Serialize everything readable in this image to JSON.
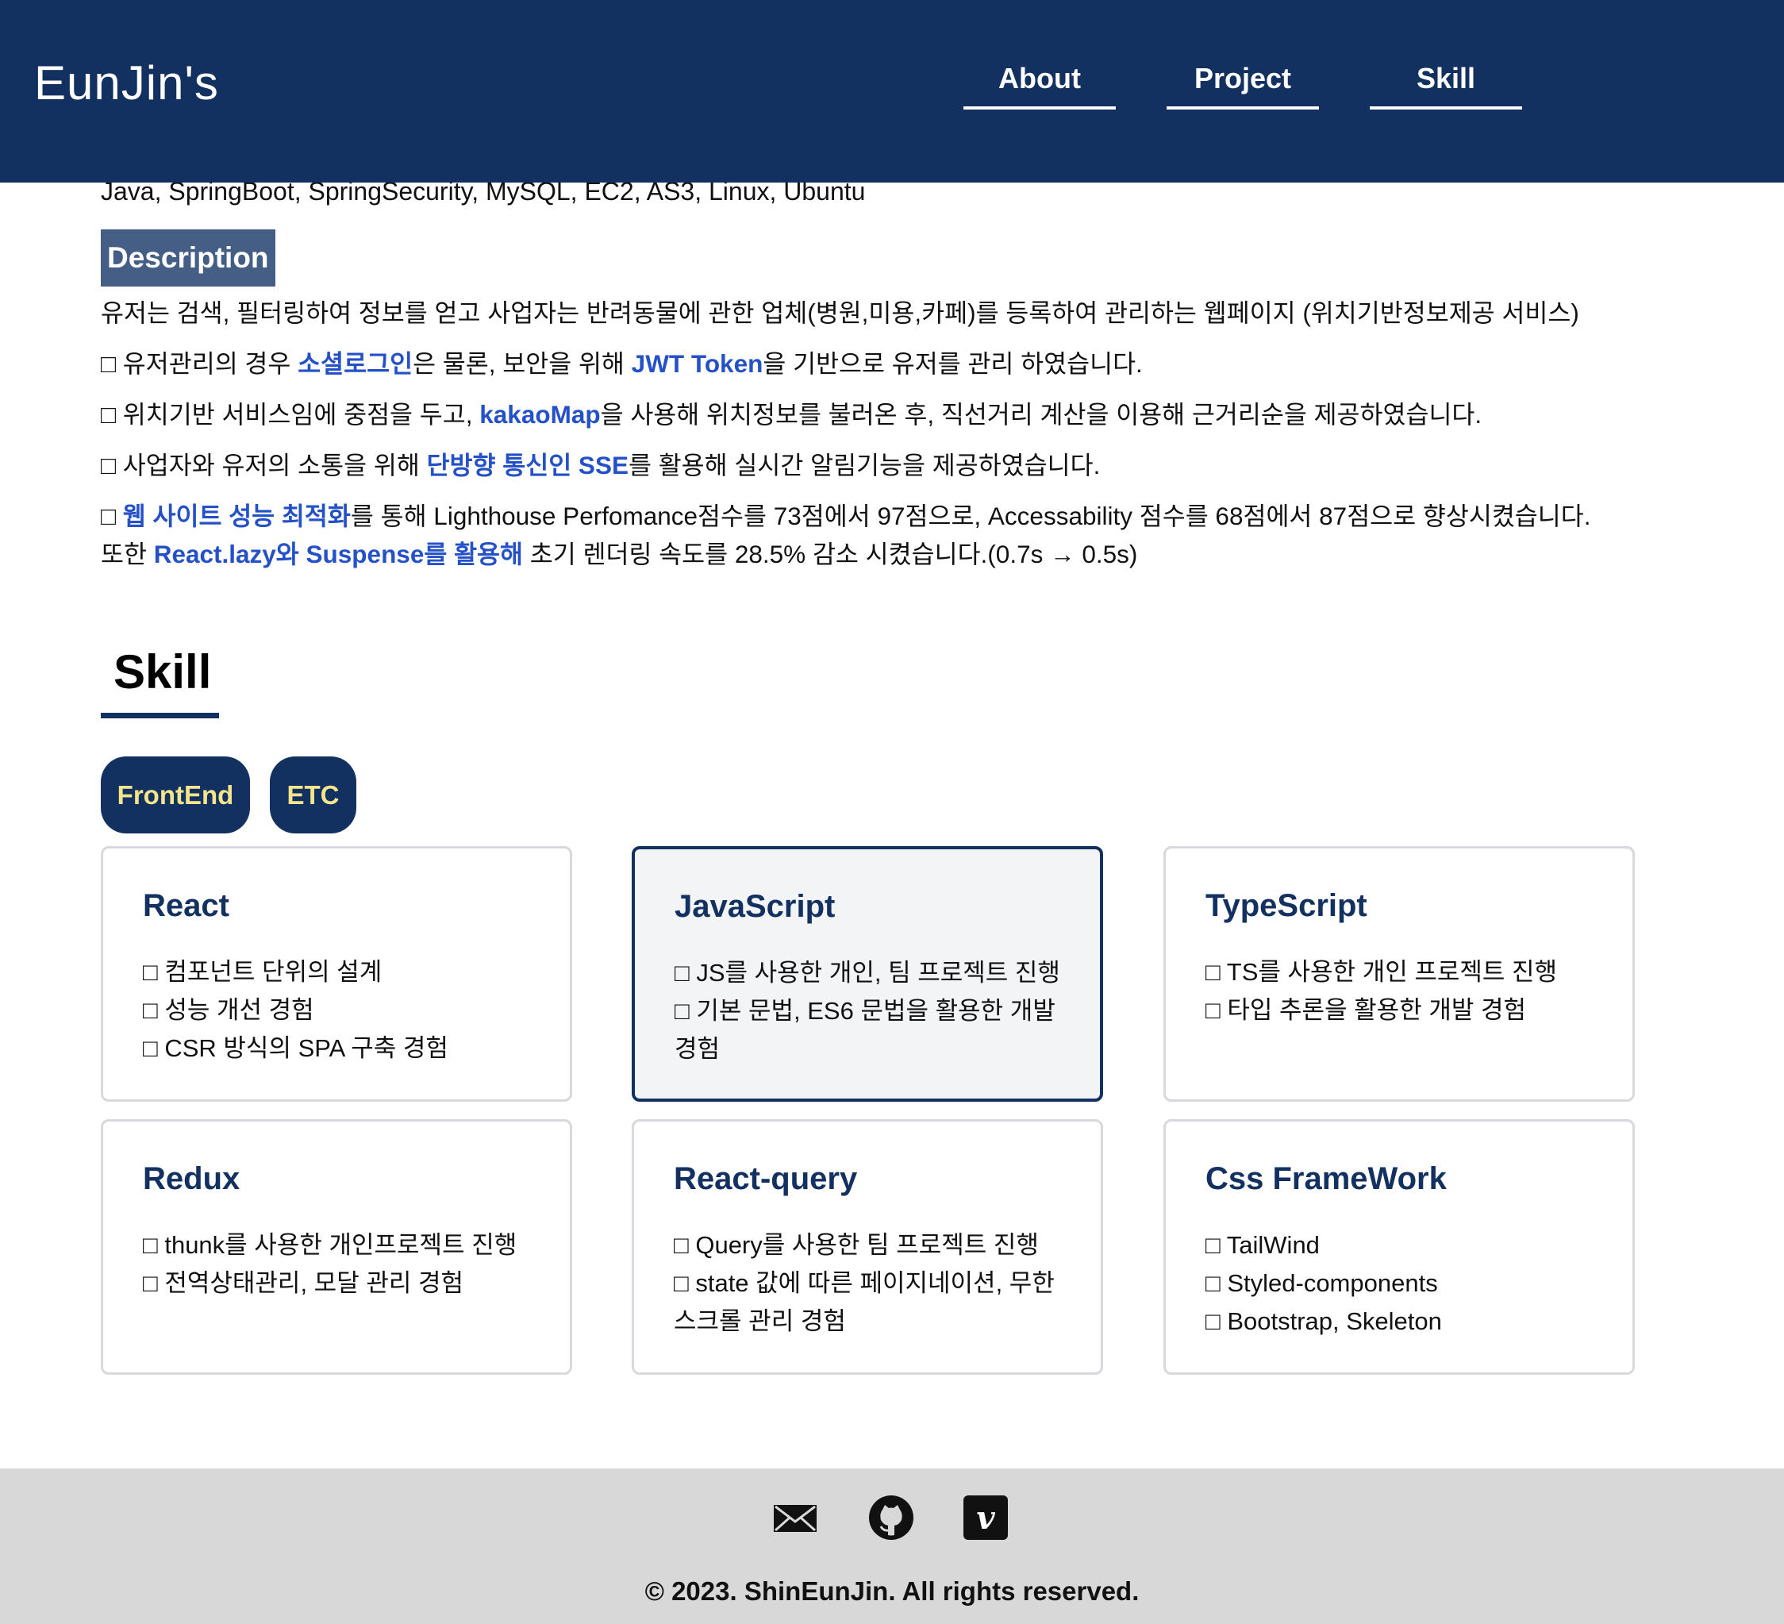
{
  "header": {
    "logo": "EunJin's",
    "nav": [
      "About",
      "Project",
      "Skill"
    ]
  },
  "project": {
    "tech_stack": "Java, SpringBoot, SpringSecurity, MySQL, EC2, AS3, Linux, Ubuntu",
    "description_label": "Description",
    "summary": "유저는 검색, 필터링하여 정보를 얻고 사업자는 반려동물에 관한 업체(병원,미용,카페)를 등록하여 관리하는 웹페이지 (위치기반정보제공 서비스)",
    "bullets": [
      {
        "pre": "□ 유저관리의 경우 ",
        "h1": "소셜로그인",
        "mid": "은 물론, 보안을 위해 ",
        "h2": "JWT Token",
        "post": "을 기반으로 유저를 관리 하였습니다."
      },
      {
        "pre": "□ 위치기반 서비스임에 중점을 두고, ",
        "h1": "kakaoMap",
        "mid": "을 사용해 위치정보를 불러온 후, 직선거리 계산을 이용해 근거리순을 제공하였습니다.",
        "h2": "",
        "post": ""
      },
      {
        "pre": "□ 사업자와 유저의 소통을 위해 ",
        "h1": "단방향 통신인 SSE",
        "mid": "를 활용해 실시간 알림기능을 제공하였습니다.",
        "h2": "",
        "post": ""
      },
      {
        "pre": "□ ",
        "h1": "웹 사이트 성능 최적화",
        "mid": "를 통해 Lighthouse Perfomance점수를 73점에서 97점으로, Accessability 점수를 68점에서 87점으로 향상시켰습니다.",
        "h2": "",
        "post": ""
      }
    ],
    "last_line": {
      "pre": "또한 ",
      "h1": "React.lazy와 Suspense를 활용해",
      "post": " 초기 렌더링 속도를 28.5% 감소 시켰습니다.(0.7s → 0.5s)"
    }
  },
  "skill": {
    "title": "Skill",
    "tabs": [
      "FrontEnd",
      "ETC"
    ],
    "cards": [
      {
        "title": "React",
        "items": [
          "□ 컴포넌트 단위의 설계",
          "□ 성능 개선 경험",
          "□ CSR 방식의 SPA 구축 경험"
        ]
      },
      {
        "title": "JavaScript",
        "items": [
          "□ JS를 사용한 개인, 팀 프로젝트 진행",
          "□ 기본 문법, ES6 문법을 활용한 개발 경험"
        ]
      },
      {
        "title": "TypeScript",
        "items": [
          "□ TS를 사용한 개인 프로젝트 진행",
          "□ 타입 추론을 활용한 개발 경험"
        ]
      },
      {
        "title": "Redux",
        "items": [
          "□ thunk를 사용한 개인프로젝트 진행",
          "□ 전역상태관리, 모달 관리 경험"
        ]
      },
      {
        "title": "React-query",
        "items": [
          "□ Query를 사용한 팀 프로젝트 진행",
          "□ state 값에 따른 페이지네이션, 무한스크롤 관리 경험"
        ]
      },
      {
        "title": "Css FrameWork",
        "items": [
          "□ TailWind",
          "□ Styled-components",
          "□ Bootstrap, Skeleton"
        ]
      }
    ]
  },
  "footer": {
    "icons": [
      "mail-icon",
      "github-icon",
      "vimeo-icon"
    ],
    "copyright": "© 2023. ShinEunJin. All rights reserved."
  },
  "colors": {
    "header_bg": "#133160",
    "highlight": "#2450c8",
    "tab_text": "#f4e58c",
    "description_bg": "#455e86",
    "footer_bg": "#d8d8d8"
  }
}
